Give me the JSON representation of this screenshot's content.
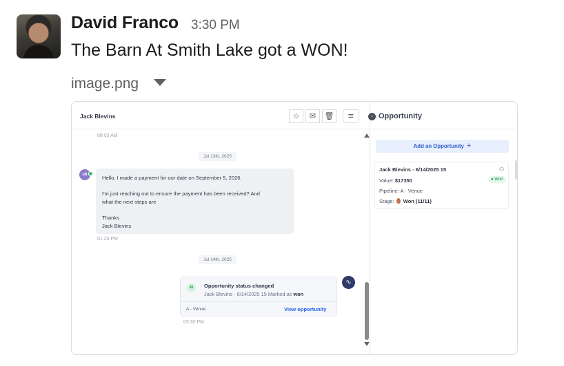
{
  "message": {
    "author": "David Franco",
    "time": "3:30 PM",
    "text": "The Barn At Smith Lake got a WON!",
    "attachment_name": "image.png"
  },
  "icons": {
    "expand": "caret-down-icon",
    "star": "star-icon",
    "mail": "envelope-open-icon",
    "trash": "trash-icon",
    "filter": "filter-icon"
  },
  "screenshot": {
    "contact_name": "Jack Blevins",
    "time_top": "08:03 AM",
    "date1": "Jul 13th, 2025",
    "avatar_initials": "JB",
    "bubble": {
      "line1": "Hello, I made a payment for our date on September 5, 2026.",
      "line2": "I'm just reaching out to ensure the payment has been received? And",
      "line3": "what the next steps are",
      "line4": "Thanks",
      "line5": "Jack Blevins"
    },
    "time_msg": "01:25 PM",
    "date2": "Jul 14th, 2025",
    "status_card": {
      "icon_text": "$$",
      "title": "Opportunity status changed",
      "subtitle": "Jack Blevins - 6/14/2025 15 Marked as",
      "status": "won",
      "pipeline": "A - Venue",
      "link": "View opportunity"
    },
    "time_status": "03:30 PM",
    "opportunity": {
      "title": "Opportunity",
      "add_label": "Add an Opportunity",
      "card_name": "Jack Blevins - 6/14/2025 15",
      "value_label": "Value:",
      "value": "$17350",
      "badge": "Won",
      "pipeline_label": "Pipeline:",
      "pipeline": "A - Venue",
      "stage_label": "Stage:",
      "stage": "Won (11/11)"
    }
  }
}
